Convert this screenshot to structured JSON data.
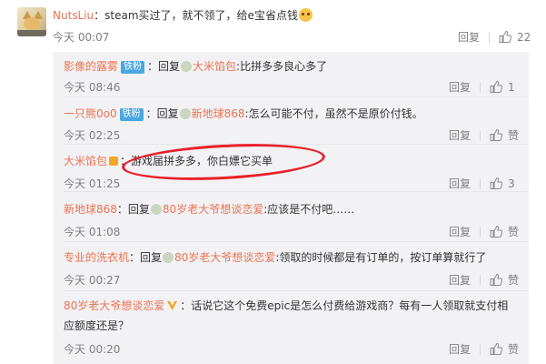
{
  "main_comment": {
    "username": "NutsLiu",
    "text": "：steam买过了，就不领了，给e宝省点钱",
    "time": "今天 00:07",
    "reply_label": "回复",
    "like_count": "22"
  },
  "replies": [
    {
      "user": "影像的露雾",
      "badge": "铁粉",
      "prefix": "：回复",
      "target": "大米馅包",
      "text": ":比拼多多良心多了",
      "time": "今天 08:46",
      "reply_label": "回复",
      "likes": "1"
    },
    {
      "user": "一只熊0o0",
      "badge": "铁粉",
      "prefix": "：回复",
      "target": "新地球868",
      "text": ":怎么可能不付，虽然不是原价付钱。",
      "time": "今天 02:25",
      "reply_label": "回复",
      "likes": "赞"
    },
    {
      "user": "大米馅包",
      "badge": "",
      "prefix": "",
      "target": "",
      "text": "：游戏届拼多多，你白嫖它买单",
      "time": "今天 01:25",
      "reply_label": "回复",
      "likes": "3"
    },
    {
      "user": "新地球868",
      "badge": "",
      "prefix": "：回复",
      "target": "80岁老大爷想谈恋爱",
      "text": ":应该是不付吧……",
      "time": "今天 01:08",
      "reply_label": "回复",
      "likes": "赞"
    },
    {
      "user": "专业的洗衣机",
      "badge": "",
      "prefix": "：回复",
      "target": "80岁老大爷想谈恋爱",
      "text": ":领取的时候都是有订单的，按订单算就行了",
      "time": "今天 00:27",
      "reply_label": "回复",
      "likes": "赞"
    },
    {
      "user": "80岁老大爷想谈恋爱",
      "badge": "",
      "prefix": "",
      "target": "",
      "text": "：话说它这个免费epic是怎么付费给游戏商？每有一人领取就支付相应额度还是？",
      "time": "今天 00:20",
      "reply_label": "回复",
      "likes": "赞"
    }
  ],
  "colors": {
    "link": "#eb7350",
    "badge": "#4aa7e0",
    "panel": "#f2f2f5",
    "highlight": "#e8202a"
  }
}
